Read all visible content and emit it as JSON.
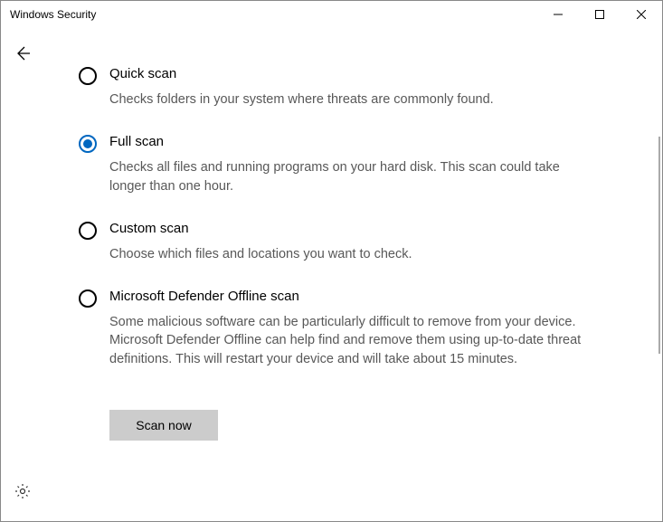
{
  "window": {
    "title": "Windows Security"
  },
  "options": {
    "quick": {
      "title": "Quick scan",
      "desc": "Checks folders in your system where threats are commonly found.",
      "selected": false
    },
    "full": {
      "title": "Full scan",
      "desc": "Checks all files and running programs on your hard disk. This scan could take longer than one hour.",
      "selected": true
    },
    "custom": {
      "title": "Custom scan",
      "desc": "Choose which files and locations you want to check.",
      "selected": false
    },
    "offline": {
      "title": "Microsoft Defender Offline scan",
      "desc": "Some malicious software can be particularly difficult to remove from your device. Microsoft Defender Offline can help find and remove them using up-to-date threat definitions. This will restart your device and will take about 15 minutes.",
      "selected": false
    }
  },
  "actions": {
    "scan_now": "Scan now"
  }
}
